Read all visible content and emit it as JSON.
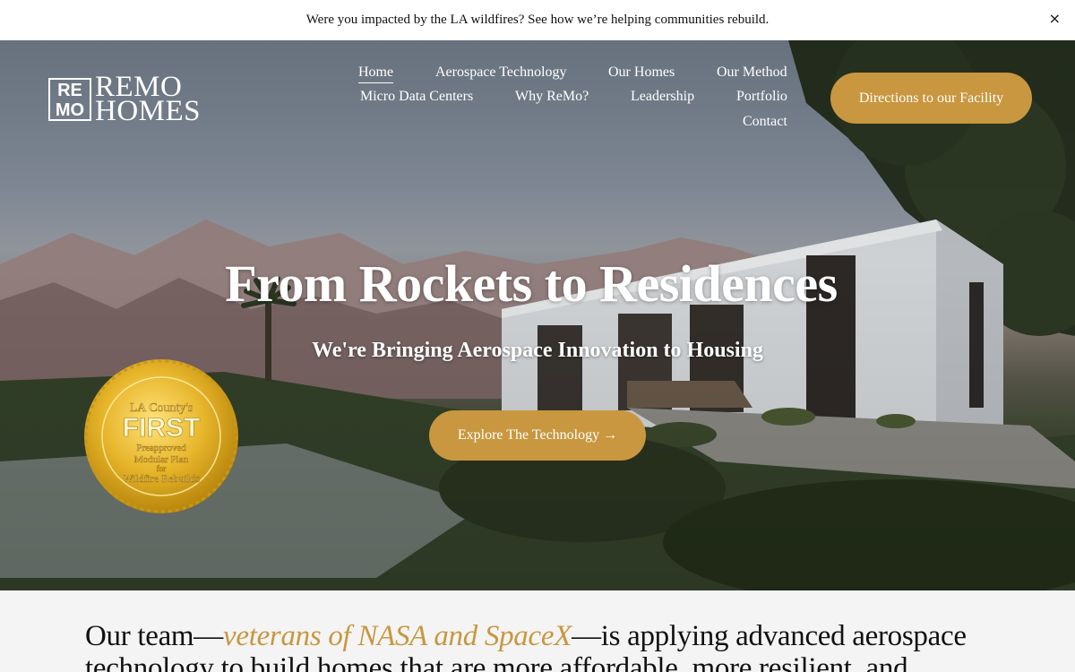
{
  "announcement": {
    "text": "Were you impacted by the LA wildfires? See how we’re helping communities rebuild.",
    "close_label": "×"
  },
  "logo": {
    "box_letters": [
      "RE",
      "MO"
    ],
    "line1": "REMO",
    "line2": "HOMES"
  },
  "nav": {
    "items": [
      {
        "label": "Home",
        "active": true
      },
      {
        "label": "Aerospace Technology"
      },
      {
        "label": "Our Homes"
      },
      {
        "label": "Our Method"
      },
      {
        "label": "Micro Data Centers"
      },
      {
        "label": "Why ReMo?"
      },
      {
        "label": "Leadership"
      },
      {
        "label": "Portfolio"
      },
      {
        "label": "Contact"
      }
    ],
    "cta_label": "Directions to our Facility"
  },
  "hero": {
    "title": "From Rockets to Residences",
    "subtitle": "We're Bringing Aerospace Innovation to Housing",
    "button_label": "Explore The Technology →"
  },
  "seal": {
    "lines": [
      "LA County's",
      "FIRST",
      "Preapproved",
      "Modular Plan",
      "for",
      "Wildfire Rebuilds"
    ]
  },
  "intro": {
    "prefix": "Our team—",
    "highlight": "veterans of NASA and SpaceX",
    "suffix": "—is applying advanced aerospace technology to build homes that are more affordable, more resilient, and"
  },
  "colors": {
    "accent": "#c8973f",
    "text": "#111111",
    "background": "#f4f4f4"
  }
}
